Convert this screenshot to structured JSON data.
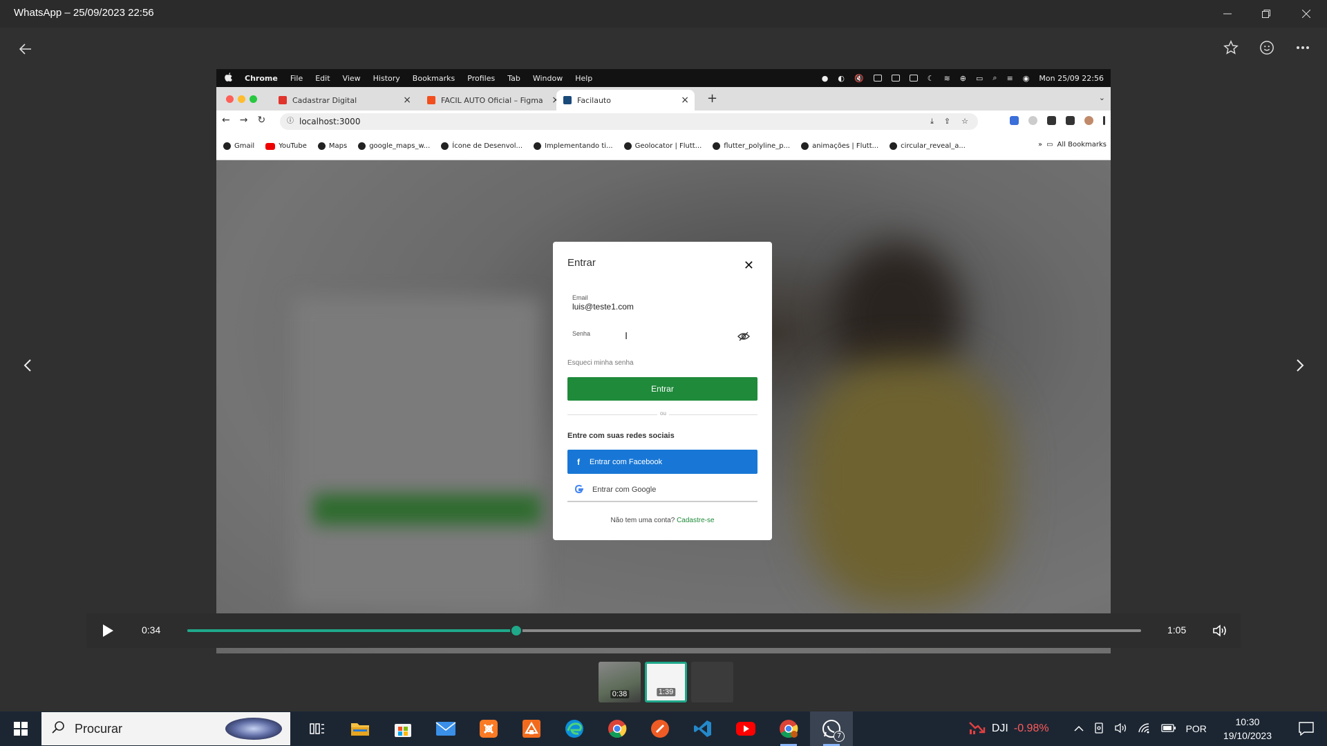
{
  "window": {
    "title": "WhatsApp – 25/09/2023 22:56"
  },
  "mac_menu": {
    "app": "Chrome",
    "items": [
      "File",
      "Edit",
      "View",
      "History",
      "Bookmarks",
      "Profiles",
      "Tab",
      "Window",
      "Help"
    ],
    "clock": "Mon 25/09 22:56"
  },
  "chrome": {
    "tabs": [
      {
        "label": "Cadastrar Digital",
        "color": "#e0342c"
      },
      {
        "label": "FACIL AUTO Oficial – Figma",
        "color": "#f24e1e"
      },
      {
        "label": "Facilauto",
        "color": "#1a4a7a"
      }
    ],
    "url": "localhost:3000",
    "bookmarks": [
      "Gmail",
      "YouTube",
      "Maps",
      "google_maps_w...",
      "Ícone de Desenvol...",
      "Implementando ti...",
      "Geolocator | Flutt...",
      "flutter_polyline_p...",
      "animações | Flutt...",
      "circular_reveal_a..."
    ],
    "all_bookmarks": "All Bookmarks"
  },
  "login_modal": {
    "title": "Entrar",
    "email_label": "Email",
    "email_value": "luis@teste1.com",
    "password_label": "Senha",
    "forgot": "Esqueci minha senha",
    "login_button": "Entrar",
    "or": "ou",
    "social_heading": "Entre com suas redes sociais",
    "facebook_button": "Entrar com Facebook",
    "google_button": "Entrar com Google",
    "signup_text": "Não tem uma conta?",
    "signup_link": "Cadastre-se"
  },
  "video": {
    "current_time": "0:34",
    "duration": "1:05",
    "progress": 0.345,
    "accent": "#1fa88a"
  },
  "thumbnails": [
    {
      "duration": "0:38"
    },
    {
      "duration": "1:39"
    },
    {
      "duration": ""
    }
  ],
  "taskbar": {
    "search_placeholder": "Procurar",
    "stock_name": "DJI",
    "stock_change": "-0.98%",
    "language": "POR",
    "time": "10:30",
    "date": "19/10/2023",
    "whatsapp_badge": "7"
  }
}
